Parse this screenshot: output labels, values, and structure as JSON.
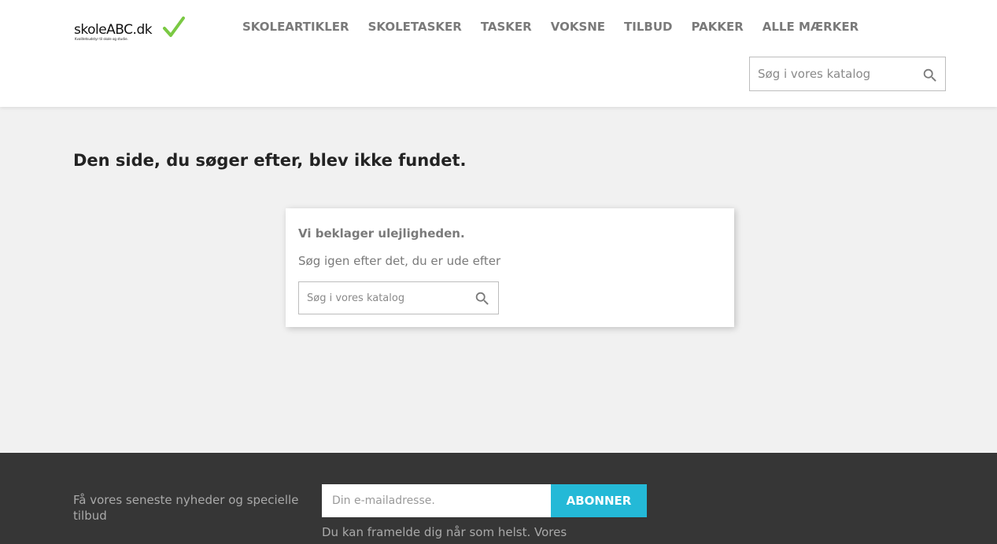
{
  "header": {
    "logo": {
      "text": "skoleABC.dk",
      "tagline": "Kvalitetsudstyr til skole og studie.",
      "check_color": "#7ac943",
      "icon": "checkmark-icon"
    },
    "nav": [
      {
        "label": "SKOLEARTIKLER"
      },
      {
        "label": "SKOLETASKER"
      },
      {
        "label": "TASKER"
      },
      {
        "label": "VOKSNE"
      },
      {
        "label": "TILBUD"
      },
      {
        "label": "PAKKER"
      },
      {
        "label": "ALLE MÆRKER"
      }
    ],
    "search": {
      "placeholder": "Søg i vores katalog",
      "icon": "search-icon"
    }
  },
  "main": {
    "title": "Den side, du søger efter, blev ikke fundet.",
    "card": {
      "heading": "Vi beklager ulejligheden.",
      "text": "Søg igen efter det, du er ude efter",
      "search_placeholder": "Søg i vores katalog",
      "icon": "search-icon"
    }
  },
  "footer": {
    "newsletter_text": "Få vores seneste nyheder og specielle tilbud",
    "email_placeholder": "Din e-mailadresse.",
    "subscribe_label": "ABONNER",
    "note": "Du kan framelde dig når som helst. Vores",
    "accent_color": "#24b9d7",
    "background_color": "#363636"
  }
}
